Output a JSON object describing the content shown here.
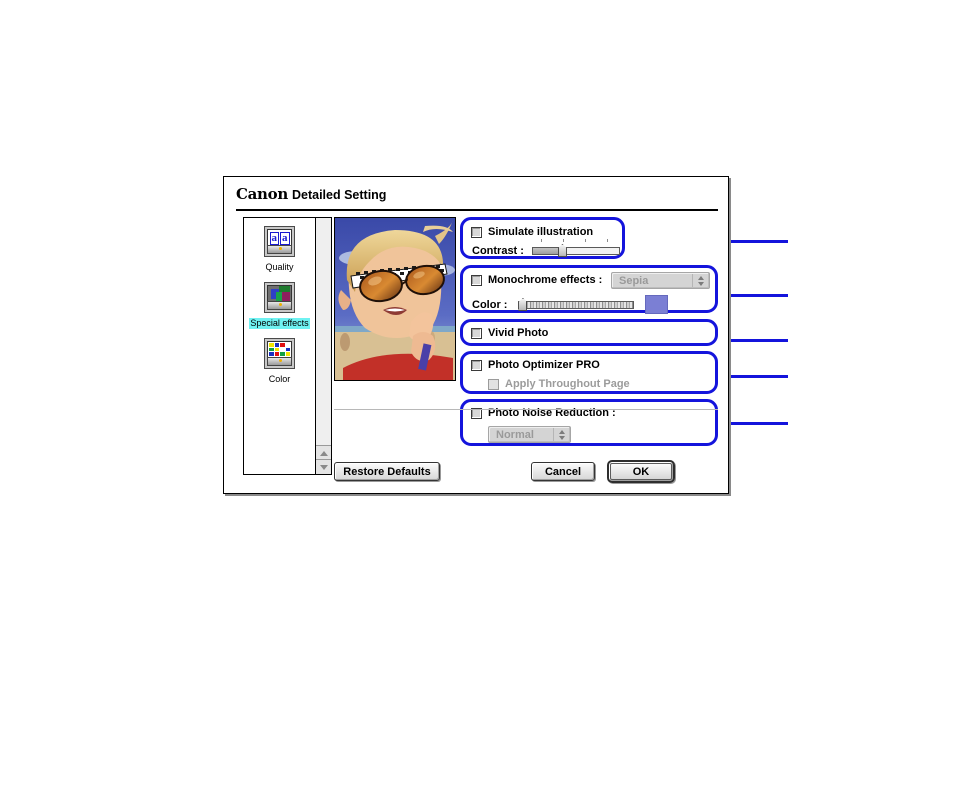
{
  "dialog": {
    "brand": "Canon",
    "title": "Detailed Setting"
  },
  "sidebar": {
    "items": [
      {
        "label": "Quality",
        "icon": "quality-icon",
        "selected": false
      },
      {
        "label": "Special effects",
        "icon": "special-effects-icon",
        "selected": true
      },
      {
        "label": "Color",
        "icon": "color-icon",
        "selected": false
      }
    ],
    "scrollbar": {
      "up_icon": "scroll-up-arrow-icon",
      "down_icon": "scroll-down-arrow-icon"
    }
  },
  "preview": {
    "alt": "photo preview of a boy wearing sunglasses at the beach"
  },
  "groups": {
    "simulate_illustration": {
      "checkbox_label": "Simulate illustration",
      "checked": false,
      "contrast_label": "Contrast :",
      "contrast_value": 33
    },
    "monochrome_effects": {
      "checkbox_label": "Monochrome effects :",
      "checked": false,
      "select_value": "Sepia",
      "select_enabled": false,
      "color_label": "Color :",
      "color_value": 0,
      "swatch_color": "#7b7fd4"
    },
    "vivid_photo": {
      "checkbox_label": "Vivid Photo",
      "checked": false
    },
    "photo_optimizer_pro": {
      "checkbox_label": "Photo Optimizer PRO",
      "checked": false,
      "sub_checkbox_label": "Apply Throughout Page",
      "sub_checked": false,
      "sub_enabled": false
    },
    "photo_noise_reduction": {
      "checkbox_label": "Photo Noise Reduction :",
      "checked": false,
      "select_value": "Normal",
      "select_enabled": false
    }
  },
  "buttons": {
    "restore_defaults": "Restore Defaults",
    "cancel": "Cancel",
    "ok": "OK"
  },
  "colors": {
    "callout": "#1414dc",
    "highlight": "#6ff2f2",
    "swatch": "#7b7fd4"
  }
}
